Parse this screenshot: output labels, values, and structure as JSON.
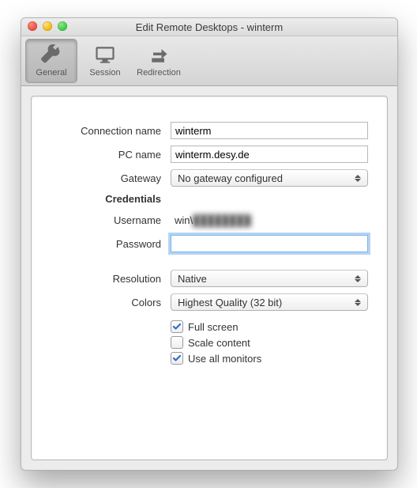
{
  "window": {
    "title": "Edit Remote Desktops - winterm"
  },
  "toolbar": {
    "general": "General",
    "session": "Session",
    "redirection": "Redirection"
  },
  "labels": {
    "connection_name": "Connection name",
    "pc_name": "PC name",
    "gateway": "Gateway",
    "credentials": "Credentials",
    "username": "Username",
    "password": "Password",
    "resolution": "Resolution",
    "colors": "Colors",
    "full_screen": "Full screen",
    "scale_content": "Scale content",
    "use_all_monitors": "Use all monitors"
  },
  "values": {
    "connection_name": "winterm",
    "pc_name": "winterm.desy.de",
    "gateway": "No gateway configured",
    "username_prefix": "win\\",
    "username_hidden": "████████",
    "password": "",
    "resolution": "Native",
    "colors": "Highest Quality (32 bit)",
    "full_screen": true,
    "scale_content": false,
    "use_all_monitors": true
  },
  "colors": {
    "check": "#2a6fc9"
  }
}
